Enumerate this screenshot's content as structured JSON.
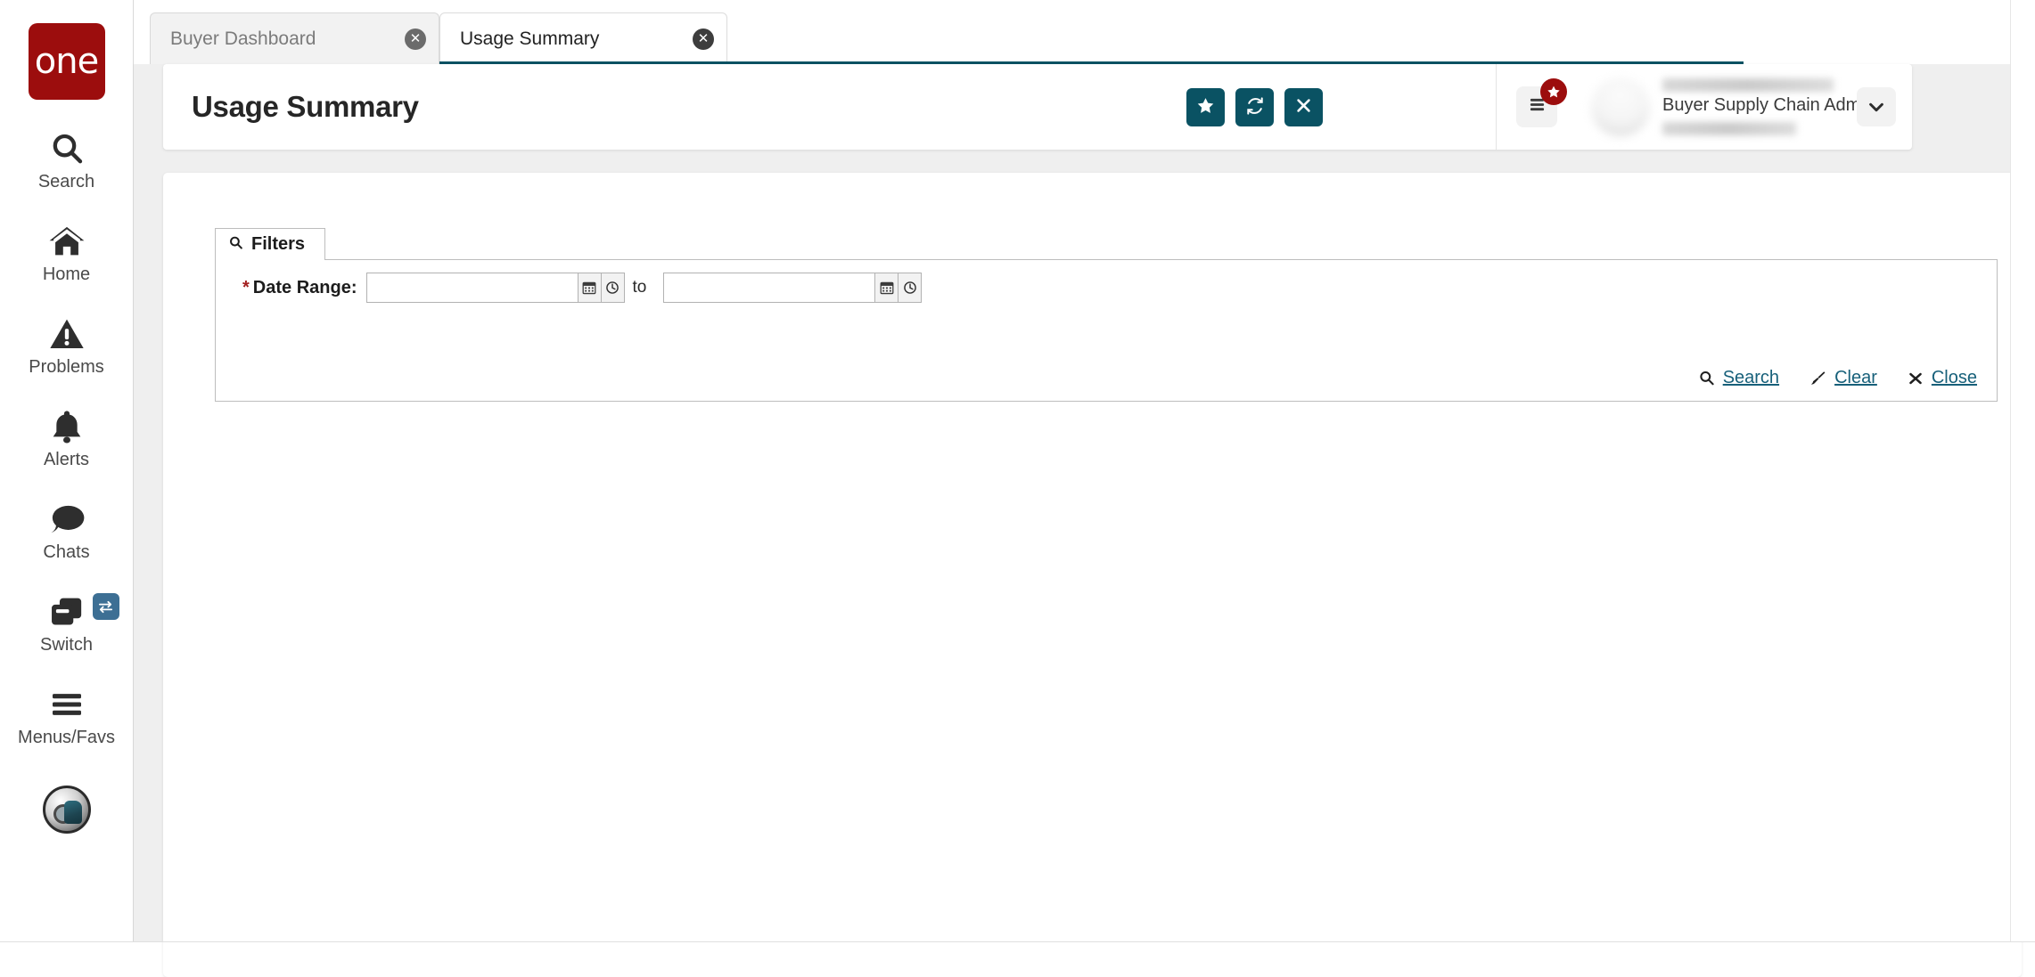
{
  "brand": {
    "logo_text": "one",
    "logo_color": "#9c0d0d"
  },
  "theme": {
    "accent": "#0a5263",
    "link": "#17607a",
    "badge_red": "#9c0d0d",
    "switch_badge": "#3d6f94"
  },
  "sidebar": {
    "items": [
      {
        "label": "Search",
        "icon": "search-icon"
      },
      {
        "label": "Home",
        "icon": "home-icon"
      },
      {
        "label": "Problems",
        "icon": "warning-triangle-icon"
      },
      {
        "label": "Alerts",
        "icon": "bell-icon"
      },
      {
        "label": "Chats",
        "icon": "chat-bubble-icon"
      },
      {
        "label": "Switch",
        "icon": "copy-windows-icon",
        "badge_icon": "exchange-arrows-icon"
      },
      {
        "label": "Menus/Favs",
        "icon": "hamburger-icon"
      }
    ],
    "bot_avatar": "bot-avatar-icon"
  },
  "tabs": [
    {
      "label": "Buyer Dashboard",
      "active": false,
      "close_icon": "close-circle-icon"
    },
    {
      "label": "Usage Summary",
      "active": true,
      "close_icon": "close-circle-icon"
    }
  ],
  "header": {
    "title": "Usage Summary",
    "actions": [
      {
        "name": "favorite-button",
        "icon": "star-icon"
      },
      {
        "name": "refresh-button",
        "icon": "refresh-icon"
      },
      {
        "name": "close-button",
        "icon": "x-icon"
      }
    ],
    "menus_favs": {
      "icon": "hamburger-icon",
      "badge_icon": "star-icon"
    },
    "user": {
      "role": "Buyer Supply Chain Admin",
      "caret_icon": "chevron-down-icon",
      "avatar": "user-avatar"
    }
  },
  "filters": {
    "tab_label": "Filters",
    "tab_icon": "search-icon",
    "date_range": {
      "label": "Date Range:",
      "required": "*",
      "from_value": "",
      "from_placeholder": "",
      "to_word": "to",
      "to_value": "",
      "to_placeholder": "",
      "calendar_icon": "calendar-icon",
      "clock_icon": "clock-icon"
    },
    "actions": [
      {
        "label": "Search",
        "icon": "search-icon"
      },
      {
        "label": "Clear",
        "icon": "broom-icon"
      },
      {
        "label": "Close",
        "icon": "x-icon"
      }
    ]
  }
}
